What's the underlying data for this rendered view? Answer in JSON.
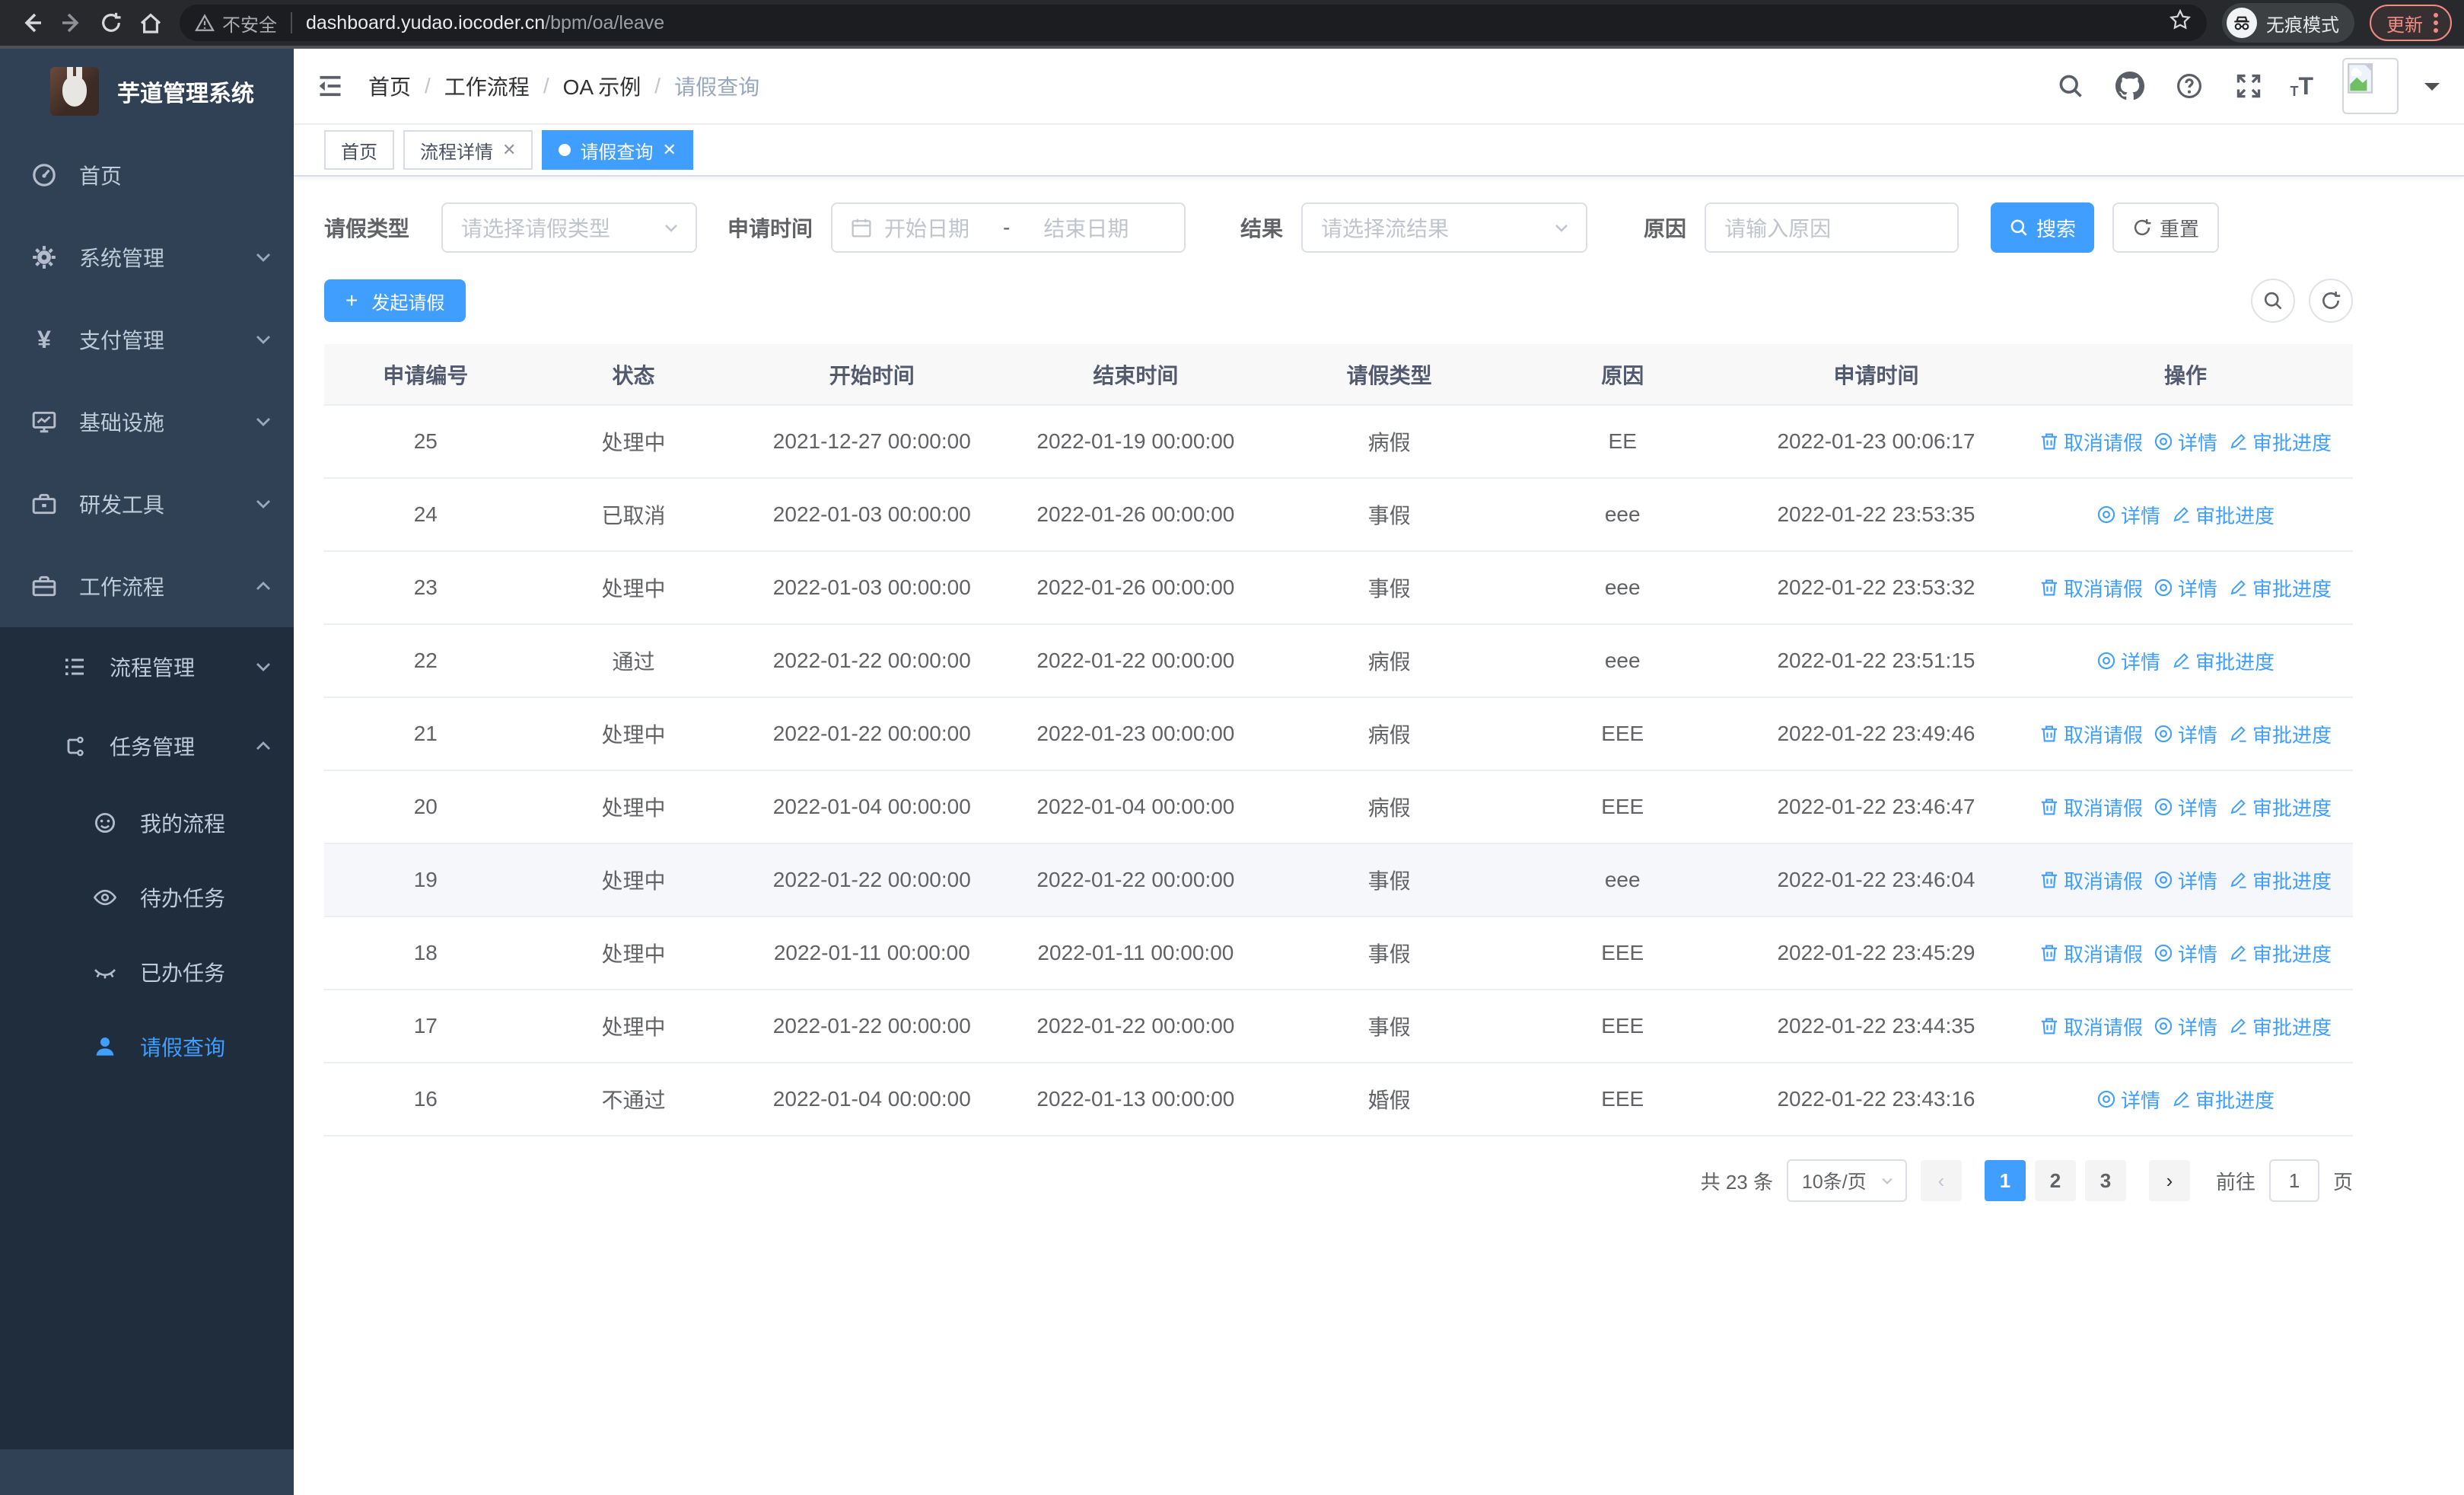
{
  "browser": {
    "security_label": "不安全",
    "url_host": "dashboard.yudao.iocoder.cn",
    "url_path": "/bpm/oa/leave",
    "incognito_label": "无痕模式",
    "update_label": "更新"
  },
  "sidebar": {
    "app_title": "芋道管理系统",
    "items": [
      {
        "label": "首页",
        "icon": "dashboard-icon"
      },
      {
        "label": "系统管理",
        "icon": "gear-icon"
      },
      {
        "label": "支付管理",
        "icon": "yen-icon"
      },
      {
        "label": "基础设施",
        "icon": "monitor-icon"
      },
      {
        "label": "研发工具",
        "icon": "toolbox-icon"
      },
      {
        "label": "工作流程",
        "icon": "briefcase-icon"
      }
    ],
    "workflow_children": [
      {
        "label": "流程管理",
        "icon": "list-tree-icon"
      },
      {
        "label": "任务管理",
        "icon": "flow-icon"
      }
    ],
    "task_children": [
      {
        "label": "我的流程",
        "icon": "face-icon"
      },
      {
        "label": "待办任务",
        "icon": "eye-icon"
      },
      {
        "label": "已办任务",
        "icon": "eye-closed-icon"
      },
      {
        "label": "请假查询",
        "icon": "user-icon"
      }
    ]
  },
  "header": {
    "breadcrumb": [
      "首页",
      "工作流程",
      "OA 示例",
      "请假查询"
    ]
  },
  "tabs": [
    {
      "label": "首页",
      "closable": false,
      "active": false
    },
    {
      "label": "流程详情",
      "closable": true,
      "active": false
    },
    {
      "label": "请假查询",
      "closable": true,
      "active": true
    }
  ],
  "filters": {
    "leave_type_label": "请假类型",
    "leave_type_placeholder": "请选择请假类型",
    "apply_time_label": "申请时间",
    "date_start_placeholder": "开始日期",
    "date_separator": "-",
    "date_end_placeholder": "结束日期",
    "result_label": "结果",
    "result_placeholder": "请选择流结果",
    "reason_label": "原因",
    "reason_placeholder": "请输入原因",
    "search_button": "搜索",
    "reset_button": "重置"
  },
  "toolbar": {
    "create_button": "发起请假"
  },
  "table": {
    "columns": [
      "申请编号",
      "状态",
      "开始时间",
      "结束时间",
      "请假类型",
      "原因",
      "申请时间",
      "操作"
    ],
    "action_labels": {
      "cancel": "取消请假",
      "detail": "详情",
      "progress": "审批进度"
    },
    "rows": [
      {
        "id": "25",
        "status": "处理中",
        "start": "2021-12-27 00:00:00",
        "end": "2022-01-19 00:00:00",
        "type": "病假",
        "reason": "EE",
        "applied": "2022-01-23 00:06:17",
        "actions": [
          "cancel",
          "detail",
          "progress"
        ]
      },
      {
        "id": "24",
        "status": "已取消",
        "start": "2022-01-03 00:00:00",
        "end": "2022-01-26 00:00:00",
        "type": "事假",
        "reason": "eee",
        "applied": "2022-01-22 23:53:35",
        "actions": [
          "detail",
          "progress"
        ]
      },
      {
        "id": "23",
        "status": "处理中",
        "start": "2022-01-03 00:00:00",
        "end": "2022-01-26 00:00:00",
        "type": "事假",
        "reason": "eee",
        "applied": "2022-01-22 23:53:32",
        "actions": [
          "cancel",
          "detail",
          "progress"
        ]
      },
      {
        "id": "22",
        "status": "通过",
        "start": "2022-01-22 00:00:00",
        "end": "2022-01-22 00:00:00",
        "type": "病假",
        "reason": "eee",
        "applied": "2022-01-22 23:51:15",
        "actions": [
          "detail",
          "progress"
        ]
      },
      {
        "id": "21",
        "status": "处理中",
        "start": "2022-01-22 00:00:00",
        "end": "2022-01-23 00:00:00",
        "type": "病假",
        "reason": "EEE",
        "applied": "2022-01-22 23:49:46",
        "actions": [
          "cancel",
          "detail",
          "progress"
        ]
      },
      {
        "id": "20",
        "status": "处理中",
        "start": "2022-01-04 00:00:00",
        "end": "2022-01-04 00:00:00",
        "type": "病假",
        "reason": "EEE",
        "applied": "2022-01-22 23:46:47",
        "actions": [
          "cancel",
          "detail",
          "progress"
        ]
      },
      {
        "id": "19",
        "status": "处理中",
        "start": "2022-01-22 00:00:00",
        "end": "2022-01-22 00:00:00",
        "type": "事假",
        "reason": "eee",
        "applied": "2022-01-22 23:46:04",
        "actions": [
          "cancel",
          "detail",
          "progress"
        ],
        "hover": true
      },
      {
        "id": "18",
        "status": "处理中",
        "start": "2022-01-11 00:00:00",
        "end": "2022-01-11 00:00:00",
        "type": "事假",
        "reason": "EEE",
        "applied": "2022-01-22 23:45:29",
        "actions": [
          "cancel",
          "detail",
          "progress"
        ]
      },
      {
        "id": "17",
        "status": "处理中",
        "start": "2022-01-22 00:00:00",
        "end": "2022-01-22 00:00:00",
        "type": "事假",
        "reason": "EEE",
        "applied": "2022-01-22 23:44:35",
        "actions": [
          "cancel",
          "detail",
          "progress"
        ]
      },
      {
        "id": "16",
        "status": "不通过",
        "start": "2022-01-04 00:00:00",
        "end": "2022-01-13 00:00:00",
        "type": "婚假",
        "reason": "EEE",
        "applied": "2022-01-22 23:43:16",
        "actions": [
          "detail",
          "progress"
        ]
      }
    ]
  },
  "pagination": {
    "total_label": "共 23 条",
    "page_size": "10条/页",
    "pages": [
      {
        "label": "1",
        "active": true
      },
      {
        "label": "2",
        "active": false
      },
      {
        "label": "3",
        "active": false
      }
    ],
    "goto_label": "前往",
    "goto_value": "1",
    "page_suffix": "页"
  },
  "colors": {
    "accent": "#409eff",
    "sidebar_bg": "#304156",
    "submenu_bg": "#1f2d3d",
    "update_button": "#f28b82"
  }
}
